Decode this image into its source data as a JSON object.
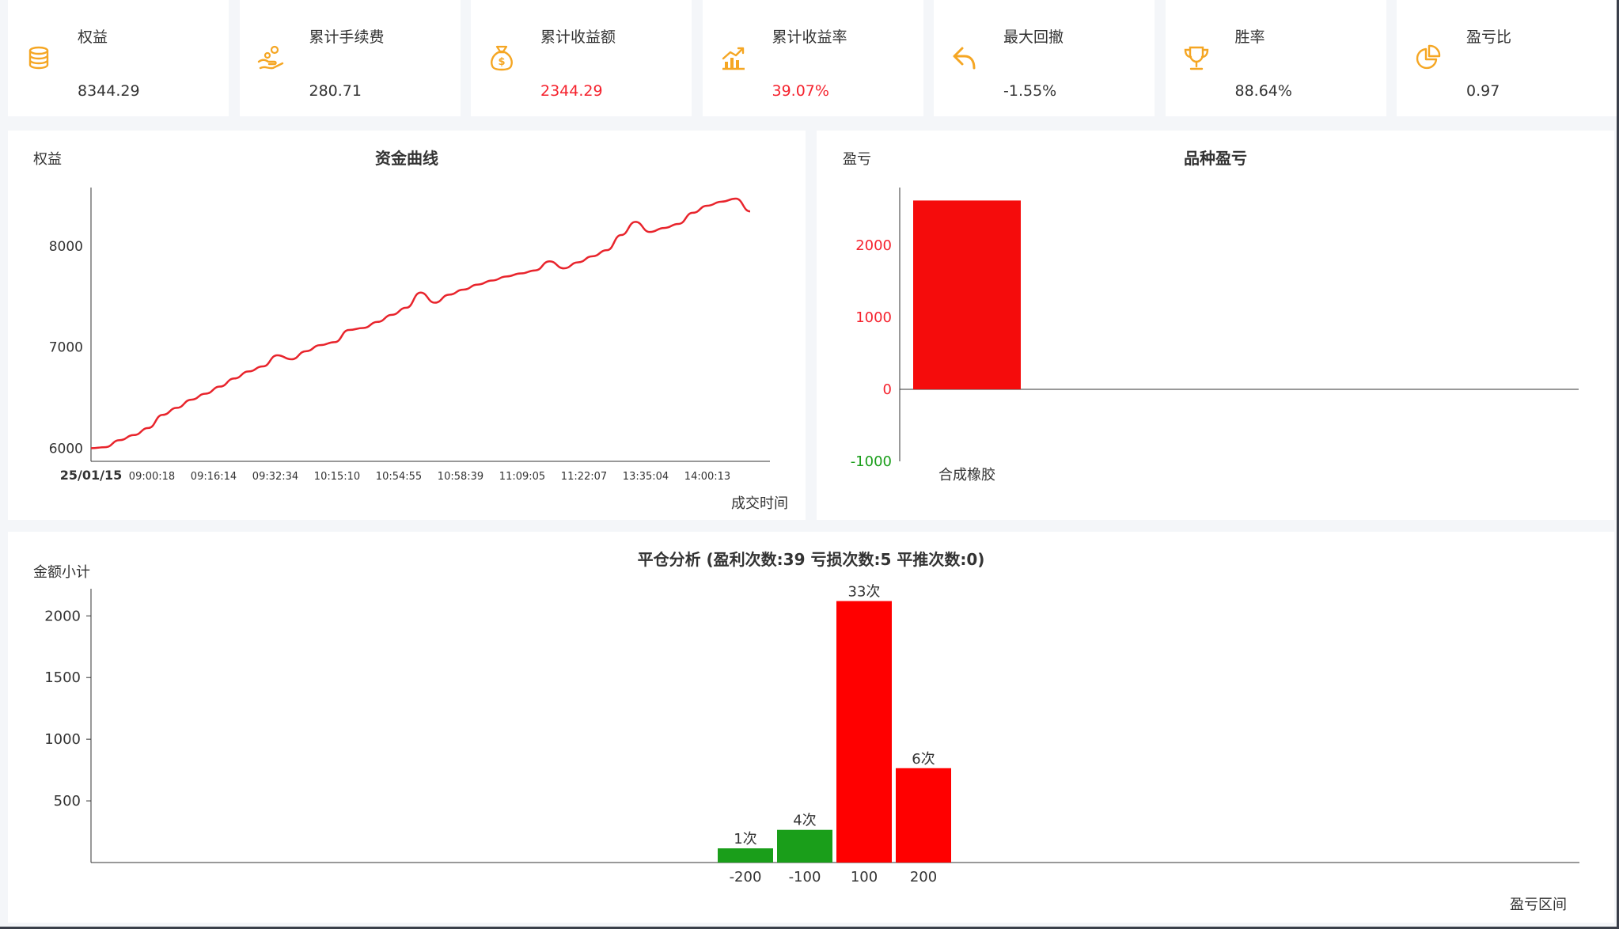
{
  "stats": [
    {
      "label": "权益",
      "value": "8344.29",
      "icon": "coins-icon",
      "highlight": false
    },
    {
      "label": "累计手续费",
      "value": "280.71",
      "icon": "hand-coins-icon",
      "highlight": false
    },
    {
      "label": "累计收益额",
      "value": "2344.29",
      "icon": "money-bag-icon",
      "highlight": true
    },
    {
      "label": "累计收益率",
      "value": "39.07%",
      "icon": "trend-chart-icon",
      "highlight": true
    },
    {
      "label": "最大回撤",
      "value": "-1.55%",
      "icon": "undo-arrow-icon",
      "highlight": false
    },
    {
      "label": "胜率",
      "value": "88.64%",
      "icon": "trophy-icon",
      "highlight": false
    },
    {
      "label": "盈亏比",
      "value": "0.97",
      "icon": "pie-icon",
      "highlight": false
    }
  ],
  "colors": {
    "accent": "#f5a623",
    "red": "#f5222d",
    "green": "#1a9e1a",
    "line": "#e8242c",
    "bar_red": "#f50c0c"
  },
  "chart_data": [
    {
      "type": "line",
      "title": "资金曲线",
      "ylabel": "权益",
      "xlabel": "成交时间",
      "first_tick_label": "25/01/15",
      "x_tick_labels": [
        "09:00:18",
        "09:16:14",
        "09:32:34",
        "10:15:10",
        "10:54:55",
        "10:58:39",
        "11:09:05",
        "11:22:07",
        "13:35:04",
        "14:00:13"
      ],
      "y_ticks": [
        6000,
        7000,
        8000
      ],
      "ylim": [
        5870,
        8580
      ],
      "values": [
        6000,
        6010,
        6080,
        6130,
        6200,
        6330,
        6400,
        6480,
        6540,
        6610,
        6690,
        6760,
        6810,
        6920,
        6880,
        6960,
        7020,
        7050,
        7170,
        7190,
        7250,
        7320,
        7390,
        7540,
        7440,
        7520,
        7570,
        7620,
        7660,
        7700,
        7730,
        7760,
        7850,
        7780,
        7840,
        7900,
        7960,
        8110,
        8240,
        8140,
        8180,
        8220,
        8330,
        8400,
        8440,
        8470,
        8344.29
      ],
      "grid": false
    },
    {
      "type": "bar",
      "title": "品种盈亏",
      "ylabel": "盈亏",
      "categories": [
        "合成橡胶"
      ],
      "values": [
        2620
      ],
      "y_ticks": [
        2000,
        1000,
        0,
        -1000
      ],
      "ylim": [
        -1000,
        2800
      ],
      "grid": false
    },
    {
      "type": "bar",
      "title": "平仓分析 (盈利次数:39 亏损次数:5 平推次数:0)",
      "ylabel": "金额小计",
      "xlabel": "盈亏区间",
      "categories": [
        "-200",
        "-100",
        "100",
        "200"
      ],
      "values": [
        115,
        265,
        2120,
        765
      ],
      "data_labels": [
        "1次",
        "4次",
        "33次",
        "6次"
      ],
      "y_ticks": [
        500,
        1000,
        1500,
        2000
      ],
      "ylim": [
        0,
        2220
      ],
      "grid": false
    }
  ]
}
